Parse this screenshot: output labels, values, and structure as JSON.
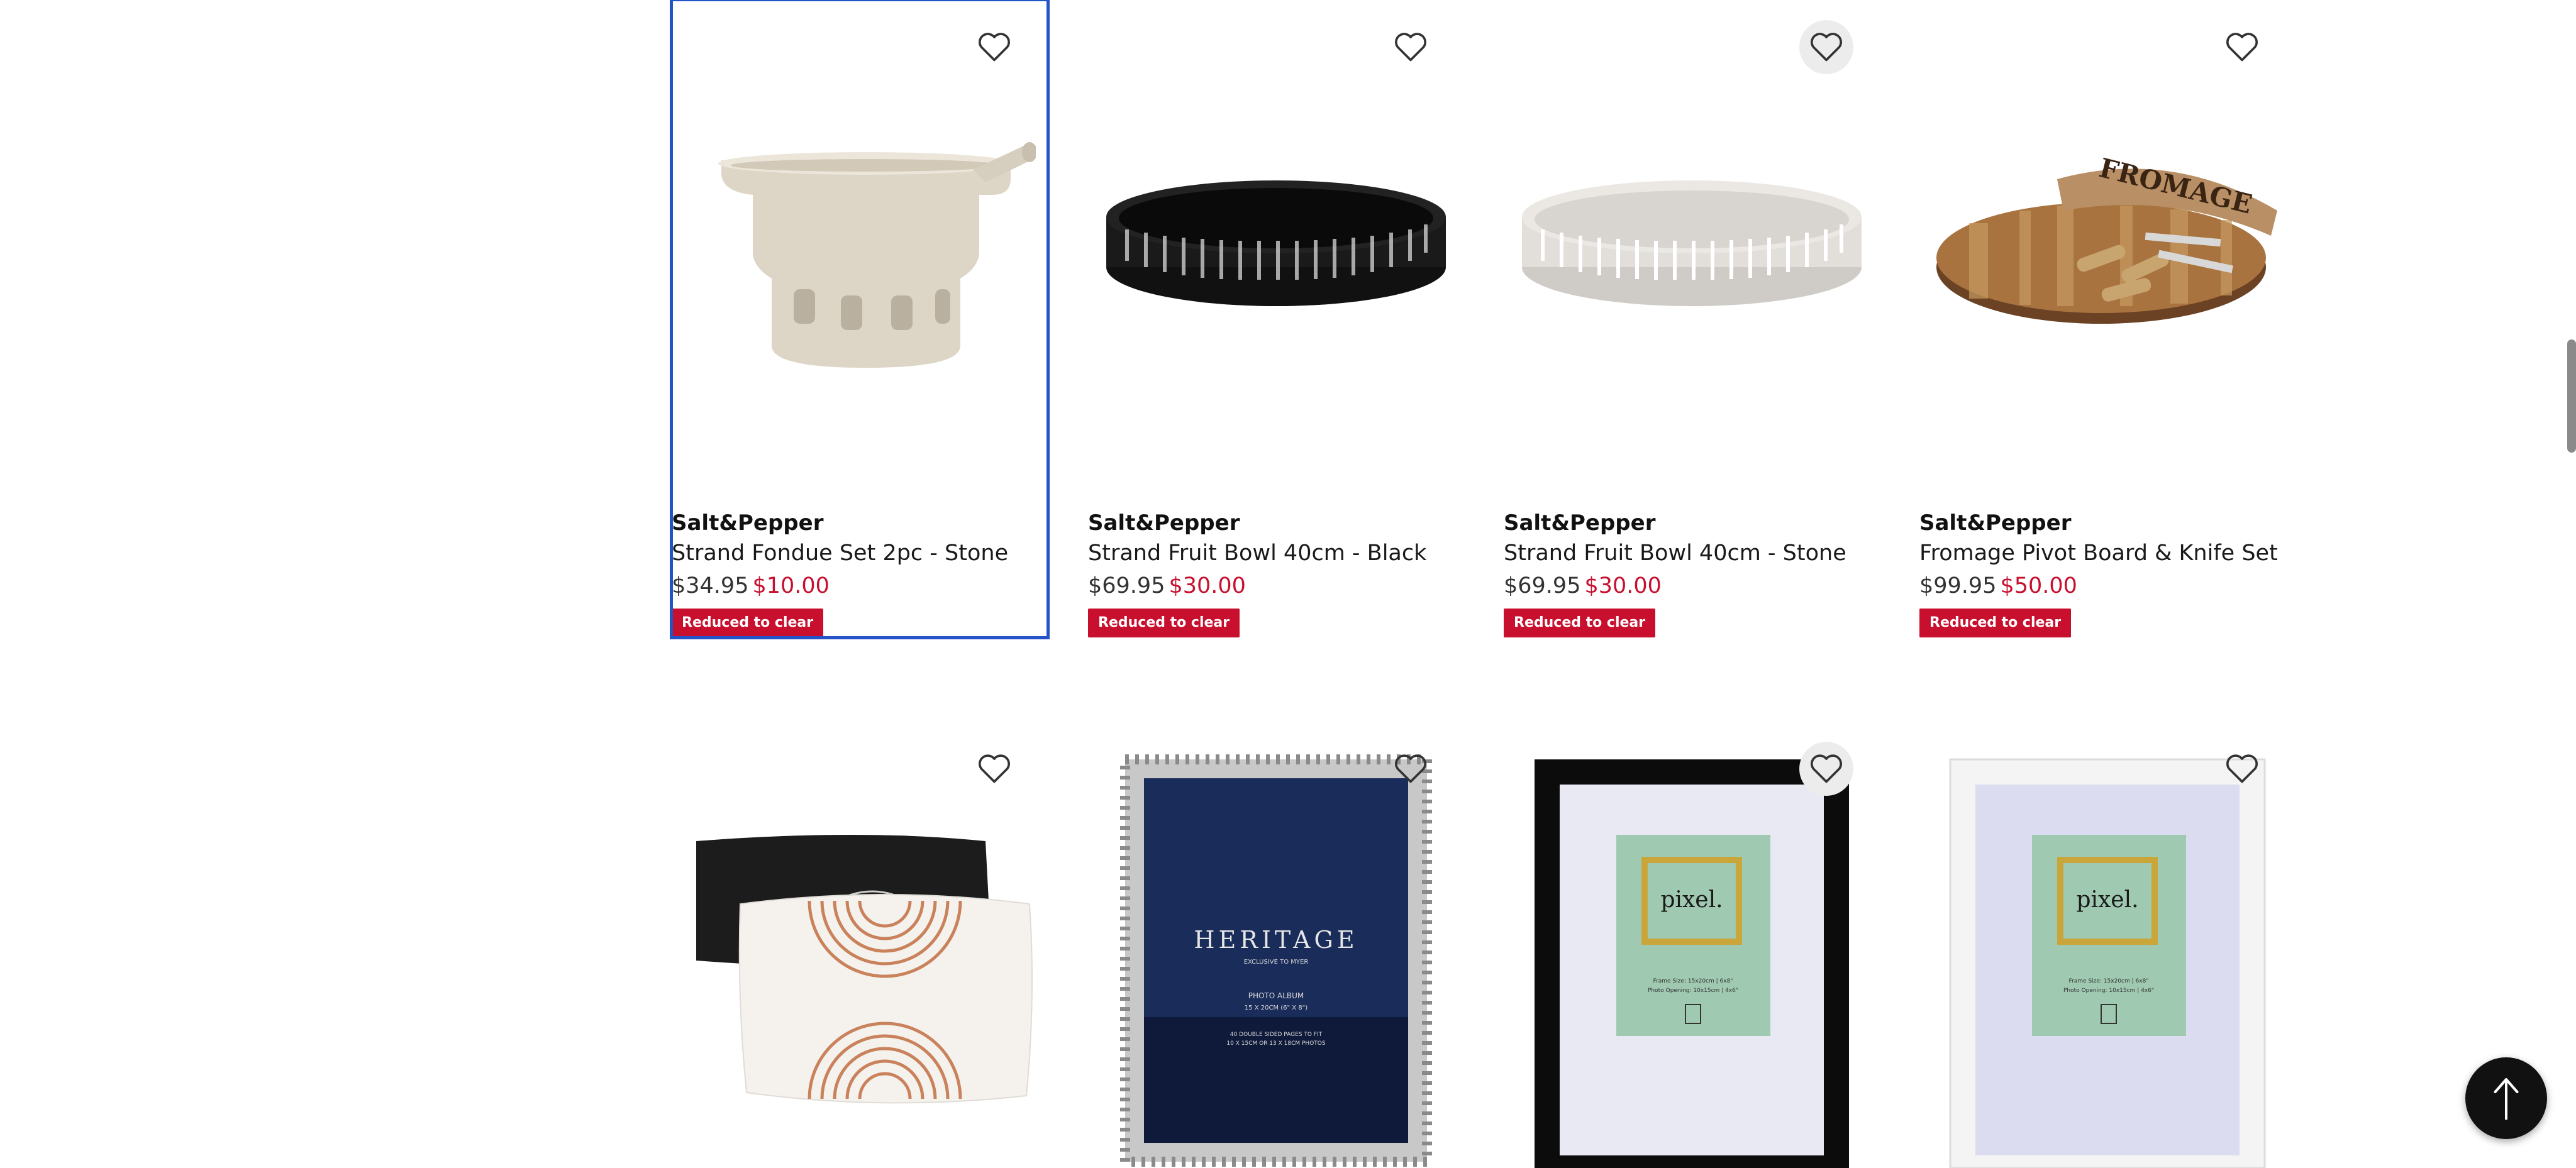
{
  "products": [
    {
      "brand": "Salt&Pepper",
      "name": "Strand Fondue Set 2pc - Stone",
      "was": "$34.95",
      "now": "$10.00",
      "badge": "Reduced to clear",
      "image": "fondue-set-image"
    },
    {
      "brand": "Salt&Pepper",
      "name": "Strand Fruit Bowl 40cm - Black",
      "was": "$69.95",
      "now": "$30.00",
      "badge": "Reduced to clear",
      "image": "black-fruit-bowl-image"
    },
    {
      "brand": "Salt&Pepper",
      "name": "Strand Fruit Bowl 40cm - Stone",
      "was": "$69.95",
      "now": "$30.00",
      "badge": "Reduced to clear",
      "image": "stone-fruit-bowl-image"
    },
    {
      "brand": "Salt&Pepper",
      "name": "Fromage Pivot Board & Knife Set",
      "was": "$99.95",
      "now": "$50.00",
      "badge": "Reduced to clear",
      "image": "cheese-board-image",
      "board_text": "FROMAGE"
    },
    {
      "image": "cushion-image"
    },
    {
      "image": "photo-album-image",
      "album": {
        "title": "HERITAGE",
        "subtitle": "EXCLUSIVE TO MYER",
        "label": "PHOTO ALBUM",
        "size": "15 X 20CM (6\" X 8\")",
        "desc1": "40 DOUBLE SIDED PAGES TO FIT",
        "desc2": "10 X 15CM OR 13 X 18CM PHOTOS"
      }
    },
    {
      "image": "black-frame-image",
      "frame": {
        "brand": "pixel.",
        "size": "Frame Size: 15x20cm | 6x8\"",
        "opening": "Photo Opening: 10x15cm | 4x6\""
      }
    },
    {
      "image": "white-frame-image",
      "frame": {
        "brand": "pixel.",
        "size": "Frame Size: 15x20cm | 6x8\"",
        "opening": "Photo Opening: 10x15cm | 4x6\""
      }
    }
  ],
  "colors": {
    "sale": "#c8102e",
    "selected_outline": "#2453c8"
  },
  "icons": {
    "wishlist": "heart-outline-icon",
    "back_to_top": "arrow-up-icon"
  }
}
